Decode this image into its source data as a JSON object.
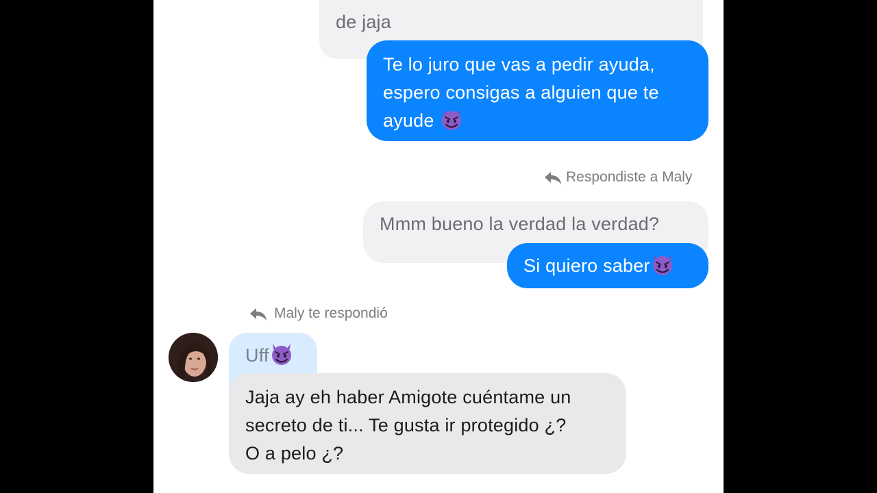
{
  "conversation": {
    "quoted_top": {
      "line2": "de jaja"
    },
    "sent_1": {
      "line1": "Te lo juro que vas a pedir ayuda,",
      "line2": "espero consigas a alguien que te",
      "line3": "ayude"
    },
    "reply_meta_1": "Respondiste a Maly",
    "quoted_2": "Mmm bueno la verdad la verdad?",
    "sent_2": "Si quiero saber",
    "reply_meta_2": "Maly te respondió",
    "quoted_3": "Uff",
    "received_1": {
      "line1": "Jaja ay eh haber Amigote cuéntame un",
      "line2": "secreto de ti... Te gusta ir protegido ¿?",
      "line3": "O a pelo ¿?"
    }
  },
  "icons": {
    "emoji": "smiling-devil-icon",
    "reply": "reply-arrow-icon"
  },
  "colors": {
    "sent_bubble": "#0a84ff",
    "received_bubble": "#e9e9ec",
    "quoted_bubble": "#f1f1f3",
    "quoted_received_bubble": "#d8ebff"
  }
}
